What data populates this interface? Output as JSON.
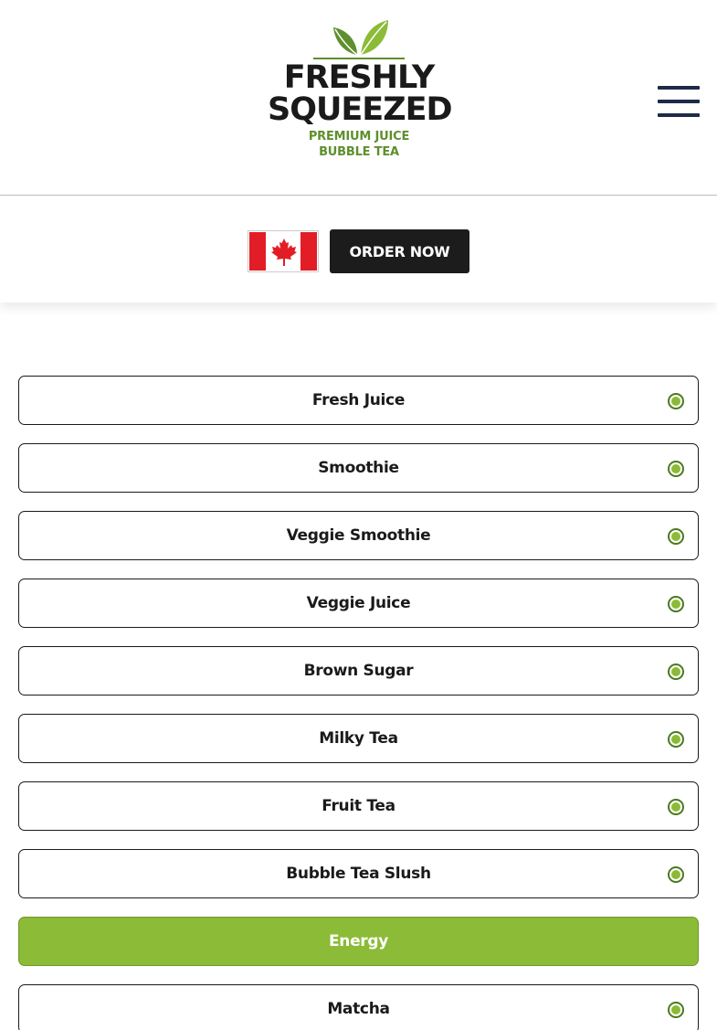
{
  "brand": {
    "line1": "FRESHLY",
    "line2": "SQUEEZED",
    "tagline1": "PREMIUM JUICE",
    "tagline2": "BUBBLE TEA",
    "accent_color": "#8bbb37",
    "tagline_color": "#5e8f2d"
  },
  "header": {
    "menu_icon": "hamburger-menu-icon"
  },
  "order_bar": {
    "flag_icon": "canada-flag-icon",
    "order_label": "ORDER NOW"
  },
  "categories": [
    {
      "label": "Fresh Juice",
      "active": false
    },
    {
      "label": "Smoothie",
      "active": false
    },
    {
      "label": "Veggie Smoothie",
      "active": false
    },
    {
      "label": "Veggie Juice",
      "active": false
    },
    {
      "label": "Brown Sugar",
      "active": false
    },
    {
      "label": "Milky Tea",
      "active": false
    },
    {
      "label": "Fruit Tea",
      "active": false
    },
    {
      "label": "Bubble Tea Slush",
      "active": false
    },
    {
      "label": "Energy",
      "active": true
    },
    {
      "label": "Matcha",
      "active": false
    }
  ]
}
